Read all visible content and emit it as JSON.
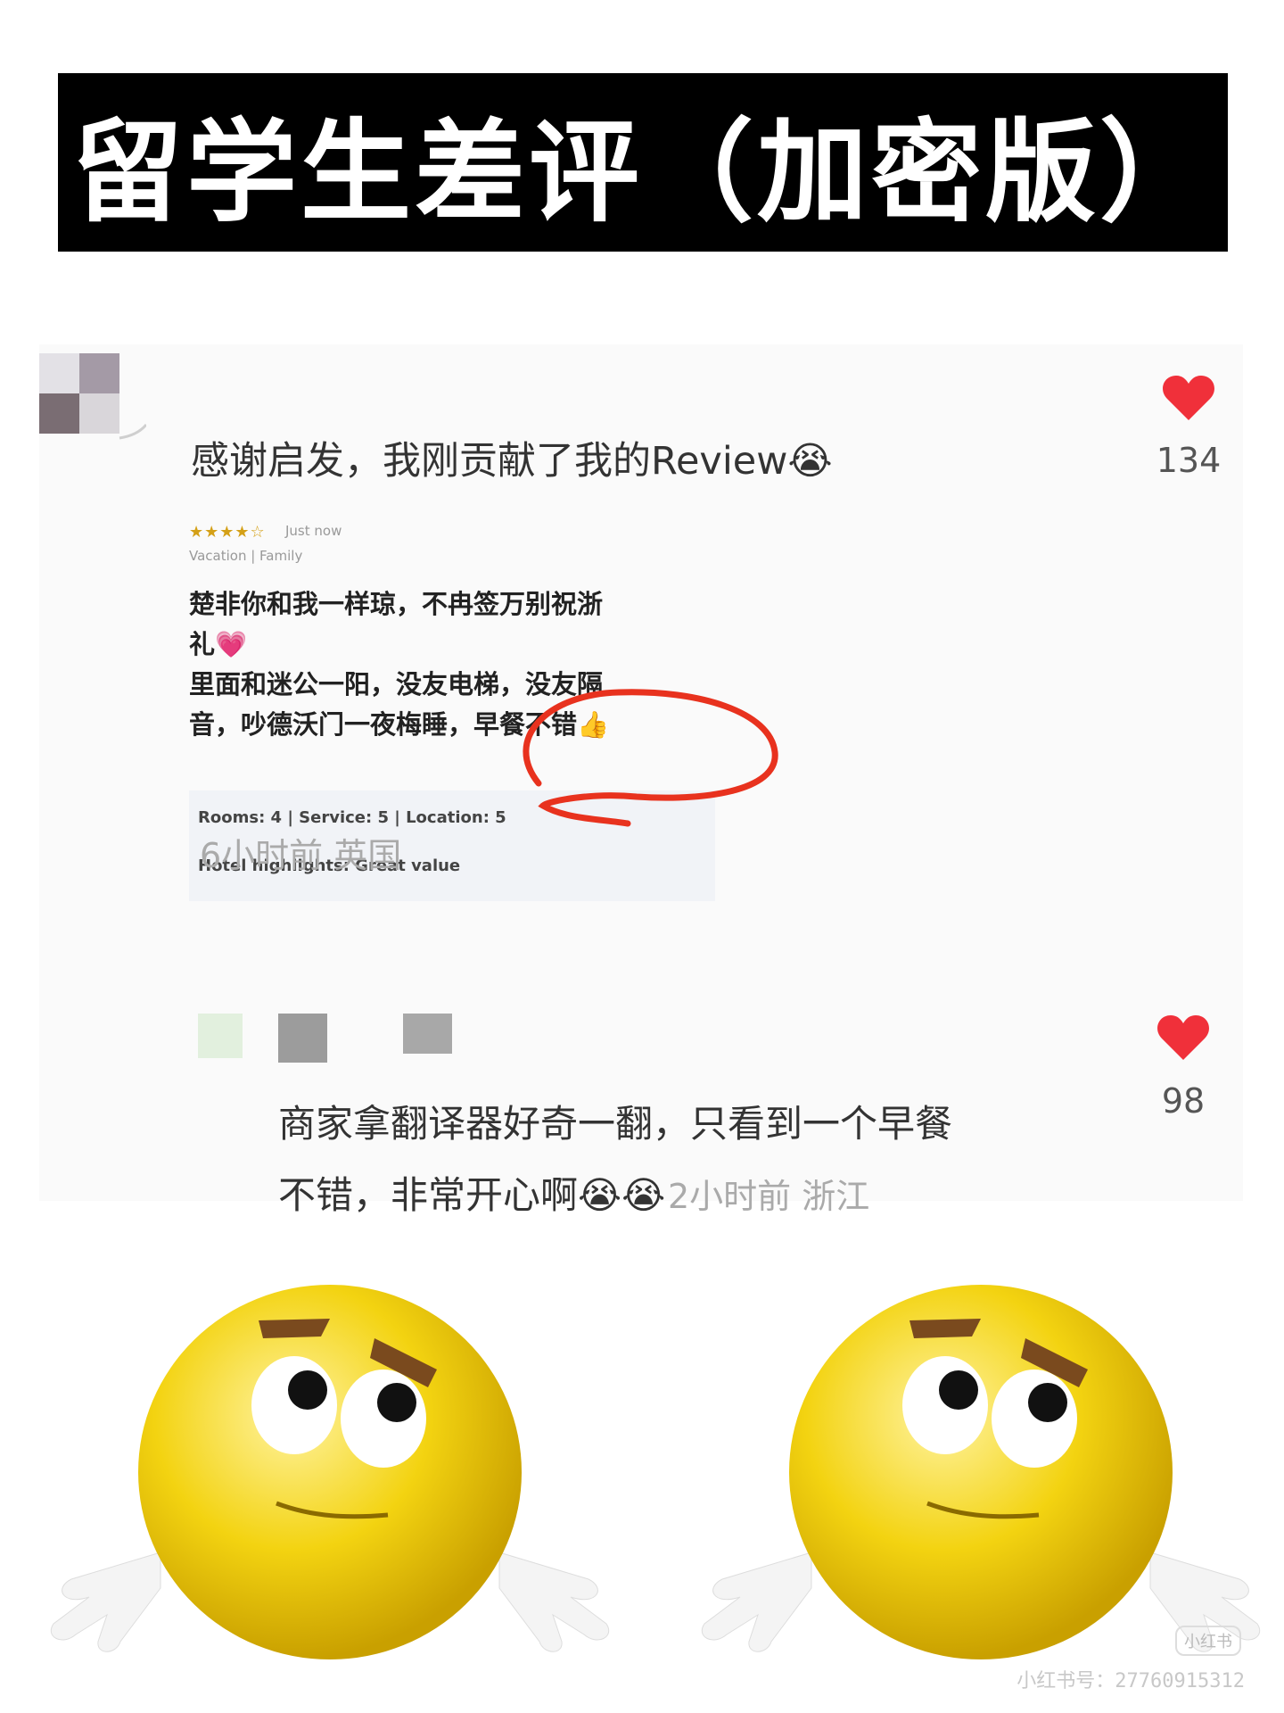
{
  "title": "留学生差评（加密版）",
  "comment1": {
    "text": "感谢启发，我刚贡献了我的Review😭",
    "likes": "134",
    "meta": "6小时前 英国"
  },
  "review": {
    "stars": "★★★★☆",
    "time": "Just now",
    "trip_type": "Vacation | Family",
    "lines": [
      "楚非你和我一样琼，不冉签万别祝浙",
      "礼💗",
      "里面和迷公一阳，没友电梯，没友隔",
      "音，吵德沃门一夜梅睡，早餐不错👍"
    ],
    "ratings": "Rooms: 4  |  Service: 5  |  Location: 5",
    "highlights": "Hotel highlights: Great value"
  },
  "comment2": {
    "line1": "商家拿翻译器好奇一翻，只看到一个早餐",
    "line2": "不错，非常开心啊😭😭",
    "meta": "2小时前 浙江",
    "likes": "98"
  },
  "colors": {
    "heart": "#f0303a",
    "highlight_circle": "#e8321e",
    "emoji_yellow": "#f3d311"
  },
  "watermark": {
    "logo": "小红书",
    "id": "小红书号：2776091531​2"
  }
}
